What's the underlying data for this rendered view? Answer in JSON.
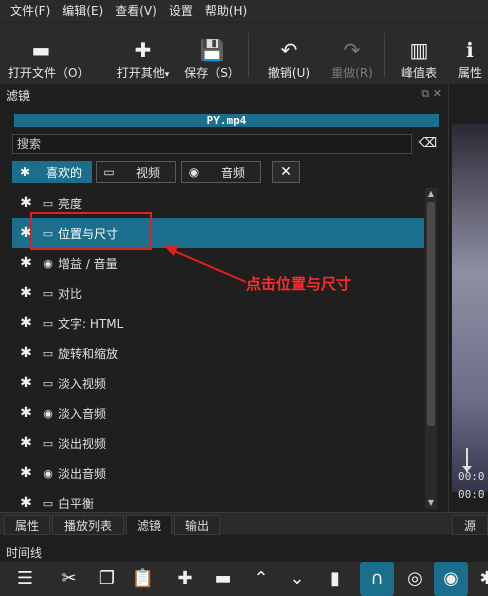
{
  "menu": [
    "文件(F)",
    "编辑(E)",
    "查看(V)",
    "设置",
    "帮助(H)"
  ],
  "toolbar": [
    {
      "label": "打开文件（O）",
      "icon": "open-file-icon",
      "glyph": "▬"
    },
    {
      "label": "打开其他",
      "icon": "open-other-icon",
      "glyph": "✚",
      "has_menu": true
    },
    {
      "label": "保存（S）",
      "icon": "save-icon",
      "glyph": "💾"
    },
    {
      "label": "撤销(U)",
      "icon": "undo-icon",
      "glyph": "↶"
    },
    {
      "label": "重做(R)",
      "icon": "redo-icon",
      "glyph": "↷",
      "disabled": true
    },
    {
      "label": "峰值表",
      "icon": "peak-meter-icon",
      "glyph": "▥"
    },
    {
      "label": "属性",
      "icon": "properties-icon",
      "glyph": "ℹ"
    }
  ],
  "panel": {
    "title": "滤镜",
    "clip_name": "PY.mp4",
    "search_placeholder": "搜索",
    "tabs": [
      {
        "label": "喜欢的",
        "icon": "star-icon",
        "active": true
      },
      {
        "label": "视频",
        "icon": "monitor-icon",
        "active": false
      },
      {
        "label": "音频",
        "icon": "audio-icon",
        "active": false
      }
    ],
    "filters": [
      {
        "name": "亮度",
        "kind": "video",
        "selected": false
      },
      {
        "name": "位置与尺寸",
        "kind": "video",
        "selected": true
      },
      {
        "name": "增益 / 音量",
        "kind": "audio",
        "selected": false
      },
      {
        "name": "对比",
        "kind": "video",
        "selected": false
      },
      {
        "name": "文字: HTML",
        "kind": "video",
        "selected": false
      },
      {
        "name": "旋转和缩放",
        "kind": "video",
        "selected": false
      },
      {
        "name": "淡入视频",
        "kind": "video",
        "selected": false
      },
      {
        "name": "淡入音频",
        "kind": "audio",
        "selected": false
      },
      {
        "name": "淡出视频",
        "kind": "video",
        "selected": false
      },
      {
        "name": "淡出音频",
        "kind": "audio",
        "selected": false
      },
      {
        "name": "白平衡",
        "kind": "video",
        "selected": false
      }
    ]
  },
  "annotation": "点击位置与尺寸",
  "preview": {
    "time_top": "00:0",
    "time_bottom": "00:0"
  },
  "bottom_tabs": [
    "属性",
    "播放列表",
    "滤镜",
    "输出"
  ],
  "bottom_tab_active": "滤镜",
  "right_tab": "源",
  "timeline": {
    "title": "时间线"
  },
  "colors": {
    "accent": "#1b6f8c",
    "annotation": "#ff2a2a"
  }
}
